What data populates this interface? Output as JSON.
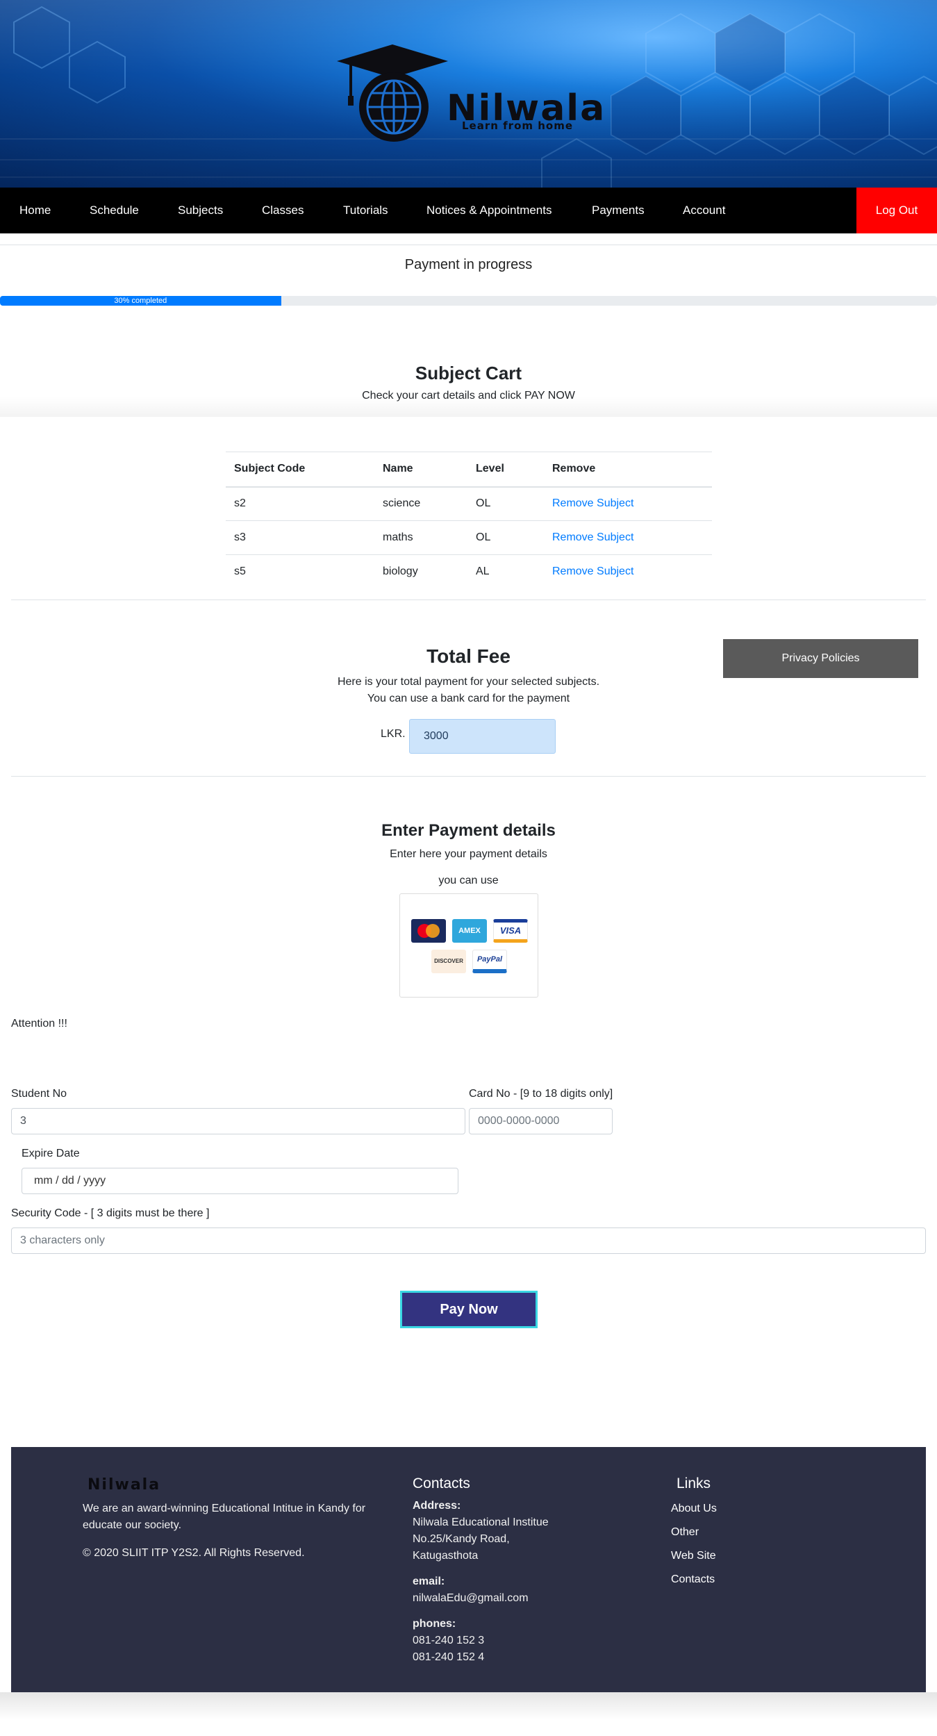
{
  "brand": {
    "name": "Nilwala",
    "tagline": "Learn from home"
  },
  "nav": {
    "items": [
      "Home",
      "Schedule",
      "Subjects",
      "Classes",
      "Tutorials",
      "Notices & Appointments",
      "Payments",
      "Account"
    ],
    "logout": "Log Out",
    "logout_color": "#ff0000"
  },
  "progress": {
    "title": "Payment in progress",
    "percent": 30,
    "label": "30% completed",
    "bar_color": "#007bff"
  },
  "cart": {
    "title": "Subject Cart",
    "subtitle": "Check your cart details and click PAY NOW",
    "columns": [
      "Subject Code",
      "Name",
      "Level",
      "Remove"
    ],
    "rows": [
      {
        "code": "s2",
        "name": "science",
        "level": "OL",
        "action": "Remove Subject"
      },
      {
        "code": "s3",
        "name": "maths",
        "level": "OL",
        "action": "Remove Subject"
      },
      {
        "code": "s5",
        "name": "biology",
        "level": "AL",
        "action": "Remove Subject"
      }
    ]
  },
  "fee": {
    "title": "Total Fee",
    "line1": "Here is your total payment for your selected subjects.",
    "line2": "You can use a bank card for the payment",
    "currency": "LKR.",
    "amount": "3000",
    "privacy_button": "Privacy Policies"
  },
  "payment": {
    "title": "Enter Payment details",
    "subtitle": "Enter here your payment details",
    "you_can_use": "you can use",
    "cards": [
      "MasterCard",
      "AMEX",
      "VISA",
      "DISCOVER",
      "PayPal"
    ],
    "attention": "Attention !!!",
    "student_no_label": "Student No",
    "student_no_value": "3",
    "card_no_label": "Card No - [9 to 18 digits only]",
    "card_no_placeholder": "0000-0000-0000",
    "expire_label": "Expire Date",
    "expire_placeholder": "mm / dd / yyyy",
    "security_label": "Security Code - [ 3 digits must be there ]",
    "security_placeholder": "3 characters only",
    "pay_button": "Pay Now"
  },
  "footer": {
    "about": "We are an award-winning Educational Intitue in Kandy for educate our society.",
    "copyright": "©  2020 SLIIT ITP Y2S2. All Rights Reserved.",
    "contacts_title": "Contacts",
    "address_label": "Address:",
    "address_lines": [
      "Nilwala Educational Institue",
      "No.25/Kandy Road,",
      "Katugasthota"
    ],
    "email_label": "email:",
    "email": "nilwalaEdu@gmail.com",
    "phones_label": "phones:",
    "phones": [
      "081-240 152 3",
      "081-240 152 4"
    ],
    "links_title": "Links",
    "links": [
      "About Us",
      "Other",
      "Web Site",
      "Contacts"
    ]
  }
}
